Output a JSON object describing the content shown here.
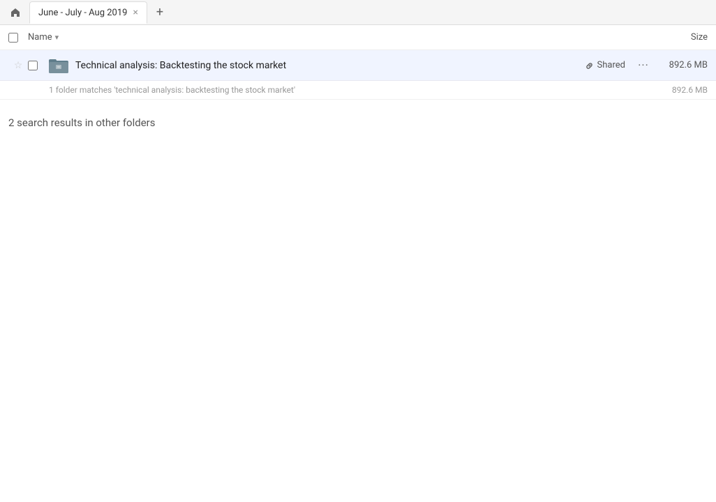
{
  "tab": {
    "label": "June - July - Aug 2019",
    "close_label": "×"
  },
  "new_tab_label": "+",
  "columns": {
    "name_label": "Name",
    "size_label": "Size"
  },
  "file_row": {
    "name": "Technical analysis: Backtesting the stock market",
    "shared_label": "Shared",
    "more_label": "···",
    "size": "892.6 MB"
  },
  "match_info": {
    "text": "1 folder matches 'technical analysis: backtesting the stock market'",
    "size": "892.6 MB"
  },
  "other_results": {
    "label": "2 search results in other folders"
  },
  "icons": {
    "home": "🏠",
    "star_empty": "☆",
    "link": "🔗",
    "chevron_down": "▾",
    "more_dots": "···"
  }
}
